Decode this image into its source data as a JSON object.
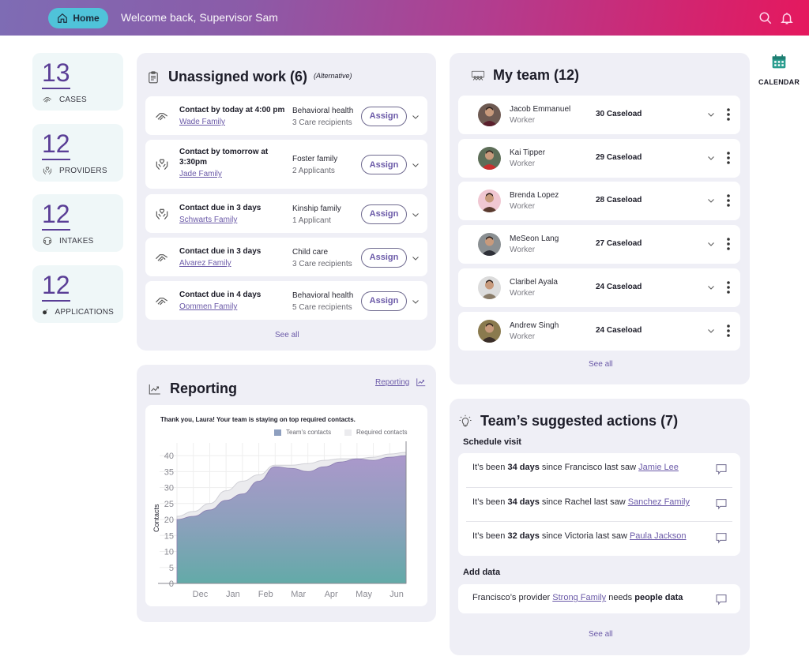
{
  "header": {
    "home_label": "Home",
    "welcome": "Welcome back, Supervisor Sam",
    "icons": [
      "search-icon",
      "bell-icon"
    ]
  },
  "tiles": [
    {
      "count": "13",
      "label": "CASES",
      "icon": "handshake-icon"
    },
    {
      "count": "12",
      "label": "PROVIDERS",
      "icon": "heart-hands-icon"
    },
    {
      "count": "12",
      "label": "INTAKES",
      "icon": "headset-icon"
    },
    {
      "count": "12",
      "label": "APPLICATIONS",
      "icon": "bomb-icon"
    }
  ],
  "unassigned": {
    "title": "Unassigned work (6)",
    "tag": "(Alternative)",
    "assign_label": "Assign",
    "see_all": "See all",
    "rows": [
      {
        "icon": "handshake-icon",
        "due": "Contact by today at 4:00 pm",
        "family": "Wade Family",
        "category": "Behavioral health",
        "count": "3 Care recipients"
      },
      {
        "icon": "heart-hands-icon",
        "due": "Contact by tomorrow at 3:30pm",
        "family": "Jade Family",
        "category": "Foster family",
        "count": "2 Applicants"
      },
      {
        "icon": "heart-hands-icon",
        "due": "Contact due in 3 days",
        "family": "Schwarts Family",
        "category": "Kinship family",
        "count": "1 Applicant"
      },
      {
        "icon": "handshake-icon",
        "due": "Contact due in 3 days",
        "family": "Alvarez Family",
        "category": "Child care",
        "count": "3 Care recipients"
      },
      {
        "icon": "handshake-icon",
        "due": "Contact due in 4 days",
        "family": "Oommen Family",
        "category": "Behavioral health",
        "count": "5 Care recipients"
      }
    ]
  },
  "team": {
    "title": "My team (12)",
    "see_all": "See all",
    "members": [
      {
        "name": "Jacob Emmanuel",
        "role": "Worker",
        "caseload": "30 Caseload",
        "avatar_bg": "#6e5a52",
        "avatar_fg": "#5a1f2c"
      },
      {
        "name": "Kai Tipper",
        "role": "Worker",
        "caseload": "29 Caseload",
        "avatar_bg": "#5d6e58",
        "avatar_fg": "#c8302e"
      },
      {
        "name": "Brenda Lopez",
        "role": "Worker",
        "caseload": "28 Caseload",
        "avatar_bg": "#f0c7d2",
        "avatar_fg": "#5a3a2e"
      },
      {
        "name": "MeSeon Lang",
        "role": "Worker",
        "caseload": "27 Caseload",
        "avatar_bg": "#8a8f92",
        "avatar_fg": "#2e3038"
      },
      {
        "name": "Claribel Ayala",
        "role": "Worker",
        "caseload": "24 Caseload",
        "avatar_bg": "#dcdcdc",
        "avatar_fg": "#8a7c68"
      },
      {
        "name": "Andrew Singh",
        "role": "Worker",
        "caseload": "24 Caseload",
        "avatar_bg": "#8a7a4e",
        "avatar_fg": "#3a2e28"
      }
    ]
  },
  "reporting": {
    "title": "Reporting",
    "link": "Reporting",
    "message": "Thank you, Laura! Your team is staying on top required contacts."
  },
  "chart_data": {
    "type": "area",
    "title": "Thank you, Laura! Your team is staying on top required contacts.",
    "xlabel": "",
    "ylabel": "Contacts",
    "categories": [
      "Dec",
      "Jan",
      "Feb",
      "Mar",
      "Apr",
      "May",
      "Jun"
    ],
    "x": [
      0,
      0.5,
      1,
      1.5,
      2,
      2.5,
      3,
      3.5,
      4,
      4.5,
      5,
      5.5,
      6,
      6.5,
      7
    ],
    "ylim": [
      0,
      42
    ],
    "yticks": [
      0,
      5,
      10,
      15,
      20,
      25,
      30,
      35,
      40
    ],
    "grid": true,
    "legend_position": "top-right",
    "series": [
      {
        "name": "Team's contacts",
        "color": "#9d8cc0",
        "values": [
          20,
          21,
          23,
          26,
          28,
          32,
          36.5,
          36,
          35,
          36.5,
          38,
          39,
          38.5,
          39.5,
          40
        ]
      },
      {
        "name": "Required contacts",
        "color": "#ebebee",
        "values": [
          21,
          22.5,
          25,
          29,
          32,
          34,
          37,
          37,
          37.5,
          38.5,
          39,
          39,
          39.5,
          40.5,
          41
        ]
      }
    ],
    "x_range_label_positions": {
      "Dec": 1,
      "Jan": 2,
      "Feb": 3,
      "Mar": 4,
      "Apr": 5,
      "May": 6,
      "Jun": 7
    }
  },
  "actions": {
    "title": "Team’s suggested actions (7)",
    "schedule_label": "Schedule visit",
    "schedule": [
      {
        "prefix": "It’s been ",
        "days": "34 days",
        "middle": " since Francisco last saw ",
        "link": "Jamie Lee"
      },
      {
        "prefix": "It’s been ",
        "days": "34 days",
        "middle": " since Rachel last saw ",
        "link": "Sanchez Family"
      },
      {
        "prefix": "It’s been ",
        "days": "32 days",
        "middle": " since Victoria last saw ",
        "link": "Paula Jackson"
      }
    ],
    "add_data_label": "Add data",
    "add_data": {
      "prefix": "Francisco’s provider ",
      "link": "Strong Family",
      "middle": " needs ",
      "bold": "people data"
    },
    "see_all": "See all"
  },
  "calendar": {
    "label": "CALENDAR",
    "color": "#2a9d8f"
  },
  "colors": {
    "accent": "#6b5aa8",
    "home_button": "#4fc3d9",
    "tile_bg": "#eff7f8",
    "panel_bg": "#efeff6"
  }
}
